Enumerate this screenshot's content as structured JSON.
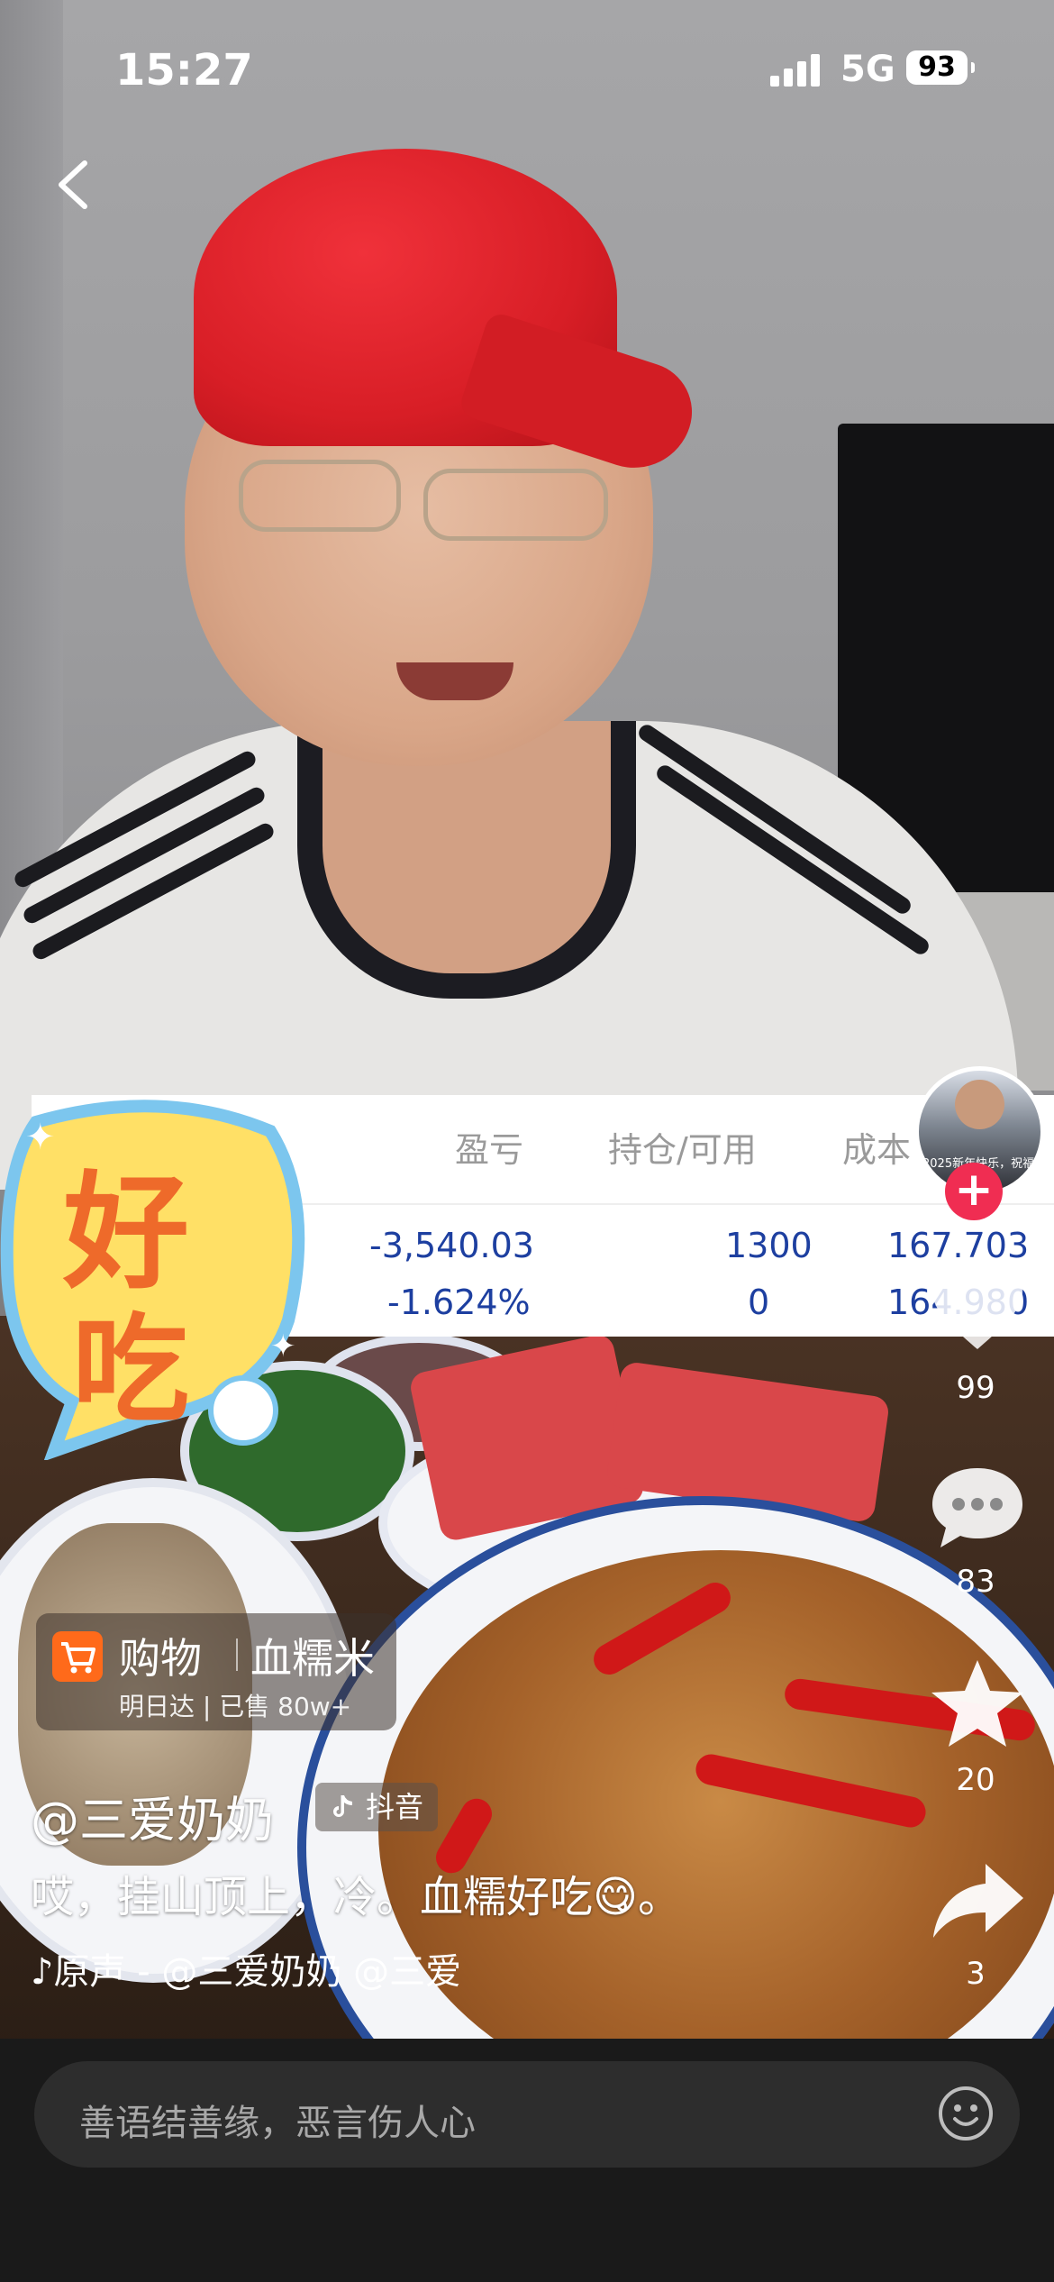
{
  "status_bar": {
    "time": "15:27",
    "network": "5G",
    "battery": "93"
  },
  "stock_panel": {
    "headers": [
      "盈亏",
      "持仓/可用",
      "成本"
    ],
    "rows": [
      {
        "pnl": "-3,540.03",
        "position": "1300",
        "cost": "167.703"
      },
      {
        "pnl": "-1.624%",
        "position": "0",
        "cost": "164.980"
      }
    ]
  },
  "sticker": {
    "text_line1": "好",
    "text_line2": "吃"
  },
  "avatar": {
    "caption": "2025新年快乐，祝福"
  },
  "actions": {
    "likes": "99",
    "comments": "83",
    "favorites": "20",
    "shares": "3"
  },
  "shop": {
    "title": "购物",
    "item": "血糯米",
    "sub": "明日达 | 已售 80w+"
  },
  "author": {
    "name": "@三爱奶奶",
    "badge": "抖音"
  },
  "caption": "哎，挂山顶上，冷。血糯好吃😋。",
  "music": "♪原声 - @三爱奶奶 @三爱",
  "comment_bar": {
    "placeholder": "善语结善缘，恶言伤人心"
  },
  "colors": {
    "follow": "#f02d52",
    "stock_blue": "#1d3fa0",
    "shop_orange": "#ff6a1a"
  }
}
